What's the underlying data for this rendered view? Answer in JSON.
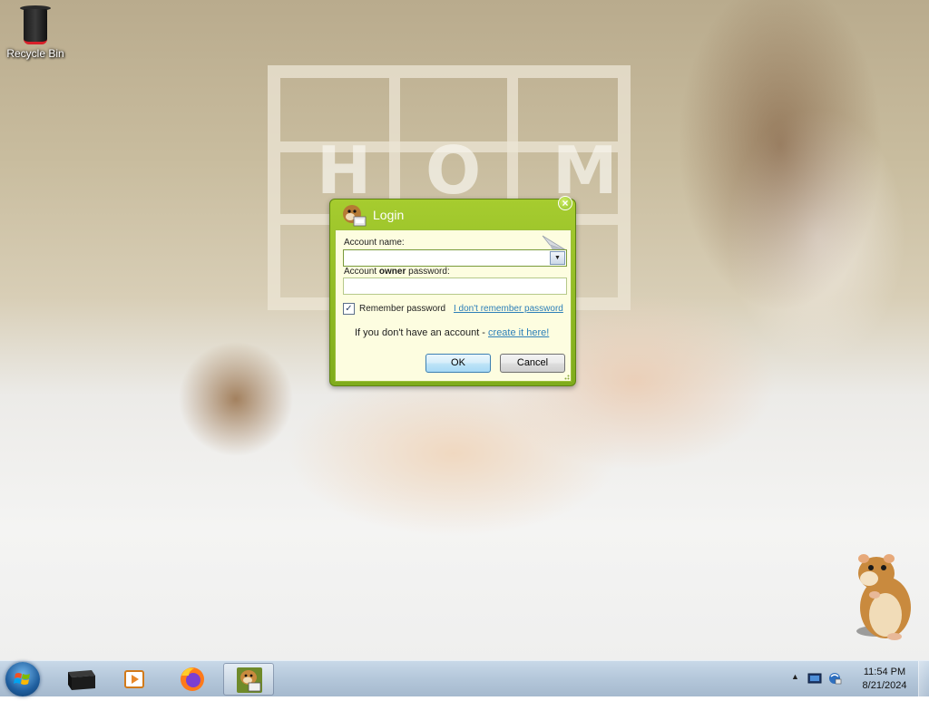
{
  "desktop": {
    "icons": [
      {
        "label": "Recycle Bin",
        "icon": "recycle-bin-icon"
      }
    ]
  },
  "login_dialog": {
    "title": "Login",
    "account_name_label": "Account name:",
    "account_name_value": "",
    "password_label_prefix": "Account ",
    "password_label_bold": "owner",
    "password_label_suffix": " password:",
    "password_value": "",
    "remember_label": "Remember password",
    "remember_checked": true,
    "forgot_link": "I don't remember password",
    "no_account_text": "If you don't have an account - ",
    "create_link": "create it here!",
    "ok_label": "OK",
    "cancel_label": "Cancel",
    "close_glyph": "×",
    "accent_color": "#8dbb24",
    "body_color": "#fdfde0"
  },
  "taskbar": {
    "pinned": [
      {
        "name": "file-manager",
        "icon": "black-box-icon"
      },
      {
        "name": "media-player",
        "icon": "media-player-icon"
      },
      {
        "name": "firefox",
        "icon": "firefox-icon"
      },
      {
        "name": "hamster-box",
        "icon": "hamster-box-icon",
        "active": true
      }
    ],
    "tray": {
      "overflow_glyph": "▲",
      "icons": [
        "action-center-icon",
        "network-icon"
      ],
      "time": "11:54 PM",
      "date": "8/21/2024"
    }
  }
}
